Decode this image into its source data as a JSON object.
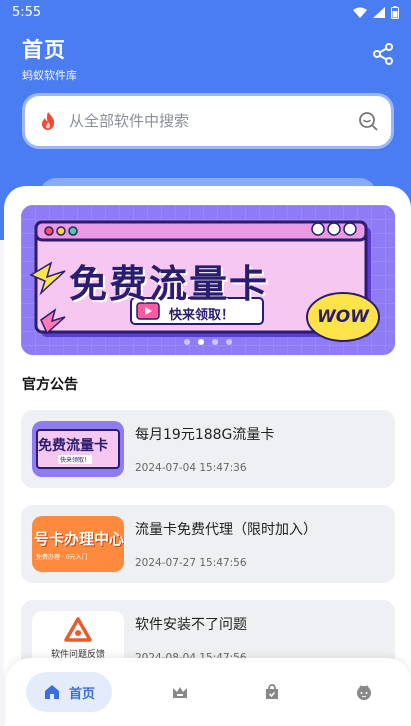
{
  "status_bar": {
    "time": "5:55"
  },
  "header": {
    "title": "首页",
    "subtitle": "蚂蚁软件库"
  },
  "search": {
    "placeholder": "从全部软件中搜索"
  },
  "banner": {
    "headline": "免费流量卡",
    "button_text": "快来领取！",
    "badge": "WOW",
    "dots_total": 4,
    "dots_active_index": 1
  },
  "notices_section": {
    "title": "官方公告"
  },
  "notices": [
    {
      "title": "每月19元188G流量卡",
      "date": "2024-07-04 15:47:36",
      "thumb_text": "免费流量卡",
      "thumb_sub": "快来领取！"
    },
    {
      "title": "流量卡免费代理（限时加入）",
      "date": "2024-07-27 15:47:56",
      "thumb_text": "号卡办理中心",
      "thumb_sub": "免费办理 · 0元入门"
    },
    {
      "title": "软件安装不了问题",
      "date": "2024-08-04 15:47:56",
      "thumb_text": "软件问题反馈"
    }
  ],
  "bottom_nav": {
    "items": [
      {
        "label": "首页",
        "icon": "home-icon",
        "active": true
      },
      {
        "label": "",
        "icon": "crown-icon",
        "active": false
      },
      {
        "label": "",
        "icon": "bag-icon",
        "active": false
      },
      {
        "label": "",
        "icon": "profile-icon",
        "active": false
      }
    ]
  },
  "colors": {
    "primary": "#4a7df2",
    "active_tab_bg": "#e4ecfb",
    "active_tab_text": "#3b6fe0"
  }
}
